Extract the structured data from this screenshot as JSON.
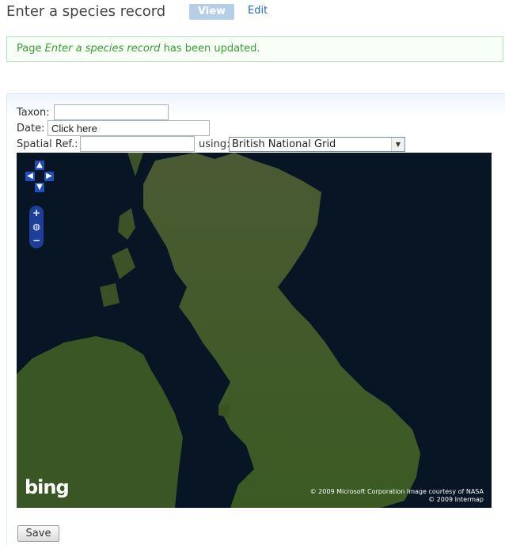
{
  "header": {
    "title": "Enter a species record",
    "tabs": [
      {
        "label": "View",
        "active": true
      },
      {
        "label": "Edit",
        "active": false
      }
    ]
  },
  "status": {
    "prefix": "Page ",
    "page_name": "Enter a species record",
    "suffix": " has been updated."
  },
  "form": {
    "taxon_label": "Taxon:",
    "taxon_value": "",
    "date_label": "Date:",
    "date_value": "Click here",
    "spatial_label": "Spatial Ref.:",
    "spatial_value": "",
    "using_label": "using:",
    "grid_system": "British National Grid",
    "save_label": "Save"
  },
  "map": {
    "logo": "bing",
    "credits_line1": "© 2009 Microsoft Corporation    Image courtesy of NASA",
    "credits_line2": "© 2009 Intermap",
    "controls": [
      "pan-up-icon",
      "pan-left-icon",
      "pan-right-icon",
      "pan-down-icon",
      "zoom-in-icon",
      "globe-icon",
      "zoom-out-icon"
    ]
  },
  "colors": {
    "accent": "#b4cfe7",
    "link": "#2266bb",
    "success_text": "#3a9a33",
    "map_sea": "#071525",
    "land": "#3f5a2a"
  }
}
